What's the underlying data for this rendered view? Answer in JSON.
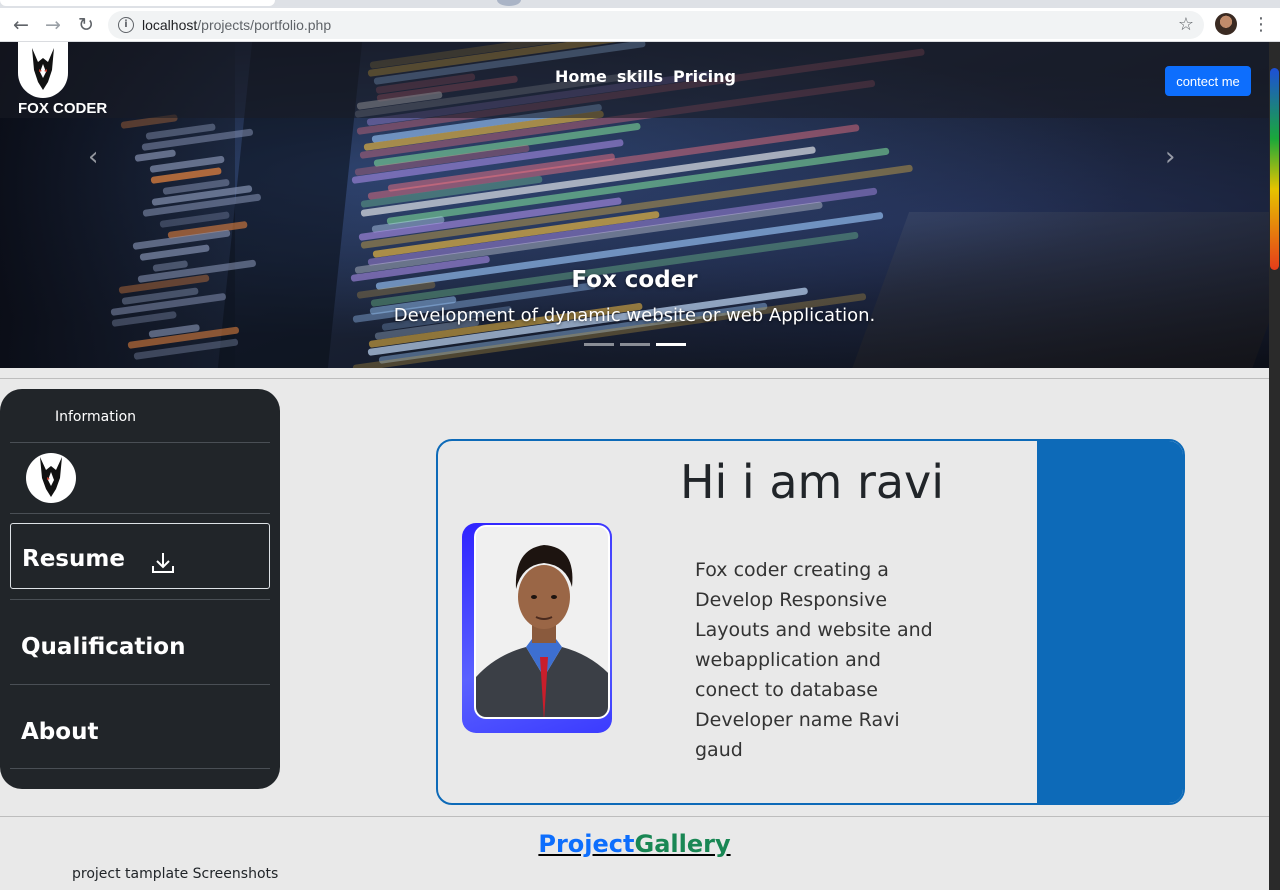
{
  "browser": {
    "url_host": "localhost",
    "url_path": "/projects/portfolio.php",
    "icons": {
      "back": "arrow-left-icon",
      "forward": "arrow-right-icon",
      "reload": "reload-icon",
      "info": "info-icon",
      "bookmark": "star-icon",
      "menu": "kebab-menu-icon"
    }
  },
  "navbar": {
    "brand": "FOX CODER",
    "links": [
      "Home",
      "skills",
      "Pricing"
    ],
    "contact_label": "contect me"
  },
  "carousel": {
    "title": "Fox coder",
    "text": "Development of dynamic website or web Application.",
    "prev_glyph": "‹",
    "next_glyph": "›",
    "slide_count": 3,
    "active_slide": 3
  },
  "sidebar": {
    "title": "Information",
    "resume_label": "Resume",
    "items": [
      "Qualification",
      "About"
    ]
  },
  "intro": {
    "heading": "Hi i am ravi",
    "text": "Fox coder creating a Develop Responsive Layouts and website and webapplication and conect to database Developer name Ravi gaud"
  },
  "gallery": {
    "title_part1": "Project",
    "title_part2": "Gallery",
    "subtitle": "project tamplate Screenshots"
  },
  "colors": {
    "accent_blue": "#0d6efd",
    "card_blue": "#0d6ab8",
    "gallery_green": "#198754",
    "sidebar_bg": "#212529"
  }
}
